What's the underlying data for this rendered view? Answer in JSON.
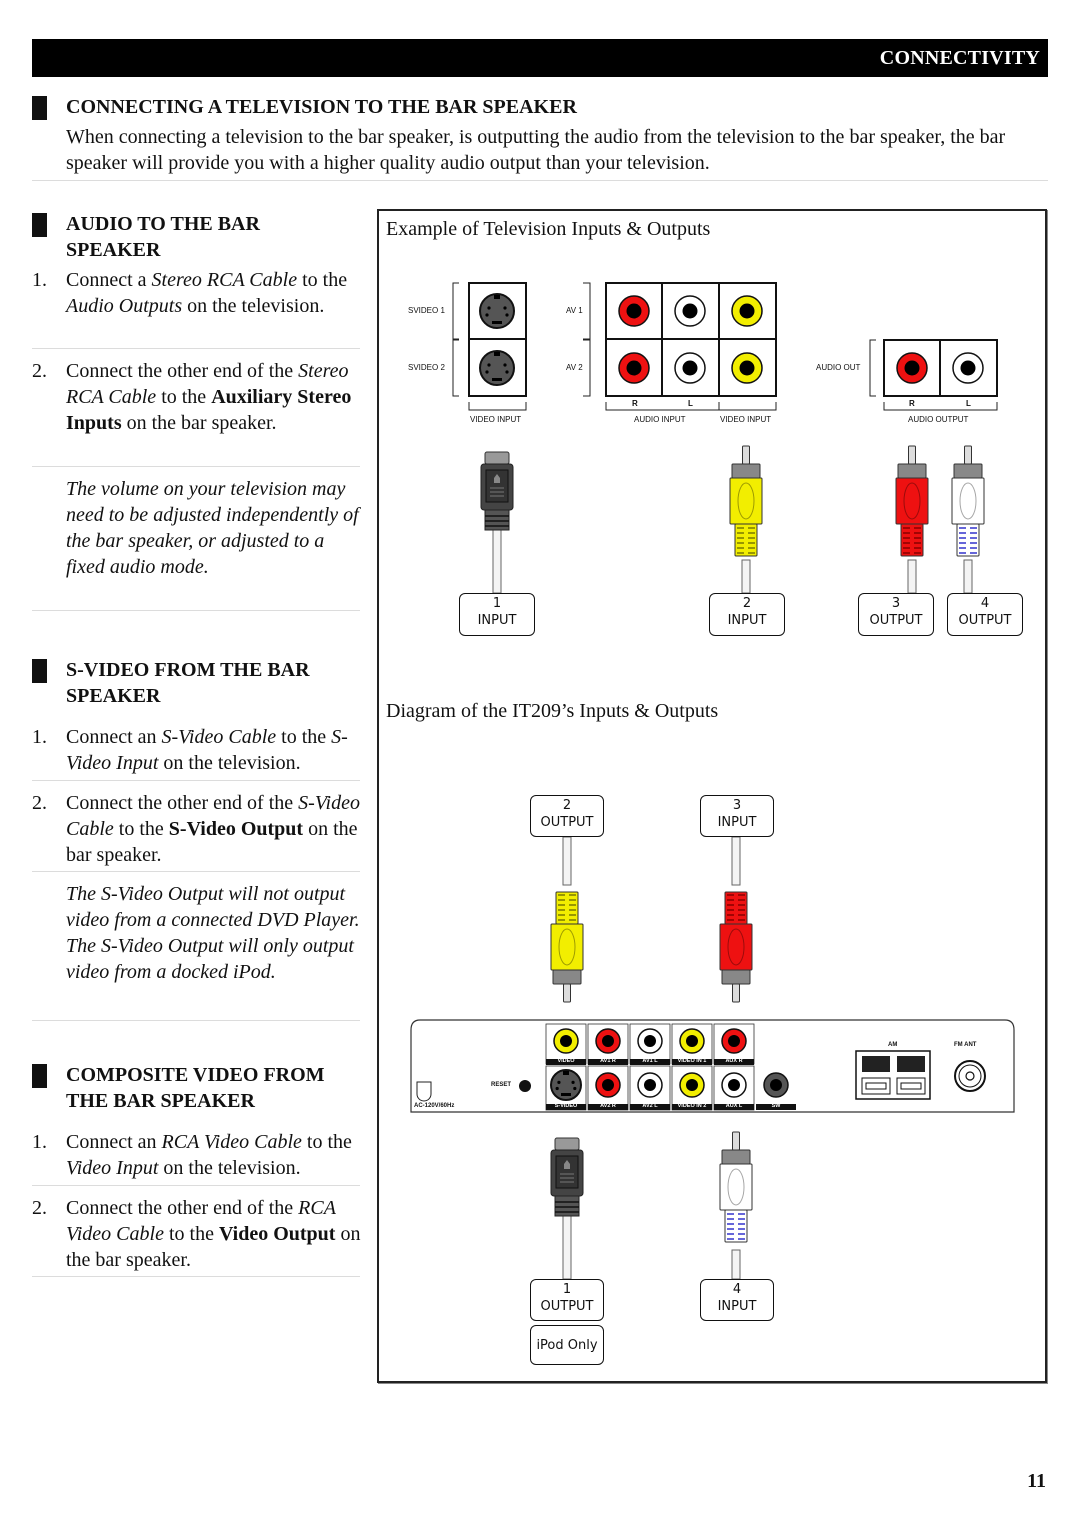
{
  "header": {
    "section_title": "CONNECTIVITY"
  },
  "main_heading": "CONNECTING A TELEVISION TO THE BAR SPEAKER",
  "intro": "When connecting a television to the bar speaker, is outputting the audio from the television to the bar speaker, the bar speaker will provide you with a higher quality audio output than your television.",
  "sections": [
    {
      "heading_line1": "AUDIO TO THE BAR",
      "heading_line2": "SPEAKER",
      "steps": [
        {
          "num": "1.",
          "parts": [
            {
              "t": "Connect a "
            },
            {
              "t": "Stereo RCA Cable",
              "i": true
            },
            {
              "t": " to the "
            },
            {
              "t": "Audio Outputs",
              "i": true
            },
            {
              "t": " on the television."
            }
          ]
        },
        {
          "num": "2.",
          "parts": [
            {
              "t": "Connect the other end of the "
            },
            {
              "t": "Stereo RCA Cable",
              "i": true
            },
            {
              "t": " to the "
            },
            {
              "t": "Auxiliary Stereo Inputs",
              "b": true
            },
            {
              "t": " on the bar speaker."
            }
          ]
        }
      ],
      "note": "The volume on your television may need to be adjusted independently of the bar speaker, or adjusted to a fixed audio mode."
    },
    {
      "heading_line1": "S-VIDEO FROM THE BAR",
      "heading_line2": "SPEAKER",
      "steps": [
        {
          "num": "1.",
          "parts": [
            {
              "t": "Connect an "
            },
            {
              "t": "S-Video Cable",
              "i": true
            },
            {
              "t": " to the "
            },
            {
              "t": "S-Video Input",
              "i": true
            },
            {
              "t": " on the television."
            }
          ]
        },
        {
          "num": "2.",
          "parts": [
            {
              "t": "Connect the other end of the "
            },
            {
              "t": "S-Video Cable",
              "i": true
            },
            {
              "t": " to the "
            },
            {
              "t": "S-Video Output",
              "b": true
            },
            {
              "t": " on the bar speaker."
            }
          ]
        }
      ],
      "note": "The S-Video Output will not output video from a connected DVD Player. The S-Video Output will only output video from a docked iPod."
    },
    {
      "heading_line1": "COMPOSITE VIDEO FROM",
      "heading_line2": "THE BAR SPEAKER",
      "steps": [
        {
          "num": "1.",
          "parts": [
            {
              "t": "Connect an "
            },
            {
              "t": "RCA Video Cable",
              "i": true
            },
            {
              "t": " to the "
            },
            {
              "t": "Video Input",
              "i": true
            },
            {
              "t": " on the television."
            }
          ]
        },
        {
          "num": "2.",
          "parts": [
            {
              "t": "Connect the other end of the "
            },
            {
              "t": "RCA Video Cable",
              "i": true
            },
            {
              "t": " to the "
            },
            {
              "t": "Video Output",
              "b": true
            },
            {
              "t": " on the bar speaker."
            }
          ]
        }
      ]
    }
  ],
  "tv_diagram": {
    "title": "Example of Television Inputs & Outputs",
    "labels": {
      "svideo1": "SVIDEO 1",
      "svideo2": "SVIDEO 2",
      "av1": "AV 1",
      "av2": "AV 2",
      "audio_out": "AUDIO OUT",
      "r": "R",
      "l": "L",
      "video_input": "VIDEO INPUT",
      "audio_input": "AUDIO INPUT",
      "audio_output": "AUDIO OUTPUT"
    },
    "connectors": [
      {
        "num": "1",
        "label": "INPUT"
      },
      {
        "num": "2",
        "label": "INPUT"
      },
      {
        "num": "3",
        "label": "OUTPUT"
      },
      {
        "num": "4",
        "label": "OUTPUT"
      }
    ]
  },
  "unit_diagram": {
    "title": "Diagram of the IT209’s Inputs & Outputs",
    "top_connectors": [
      {
        "num": "2",
        "label": "OUTPUT"
      },
      {
        "num": "3",
        "label": "INPUT"
      }
    ],
    "bottom_connectors": [
      {
        "num": "1",
        "label": "OUTPUT",
        "extra": "iPod Only"
      },
      {
        "num": "4",
        "label": "INPUT"
      }
    ],
    "panel_labels": {
      "power": "AC-120V/60Hz",
      "reset": "RESET",
      "row1": [
        "VIDEO",
        "AV1 R",
        "AV1 L",
        "VIDEO IN 1",
        "AUX R"
      ],
      "row2": [
        "S-VIDEO",
        "AV2 R",
        "AV2 L",
        "VIDEO IN 2",
        "AUX L",
        "SW"
      ],
      "am": "AM",
      "fm": "FM ANT"
    }
  },
  "colors": {
    "red": "#ee1111",
    "yellow": "#f2ee00",
    "white": "#ffffff",
    "svideo": "#555555"
  },
  "page_number": "11"
}
